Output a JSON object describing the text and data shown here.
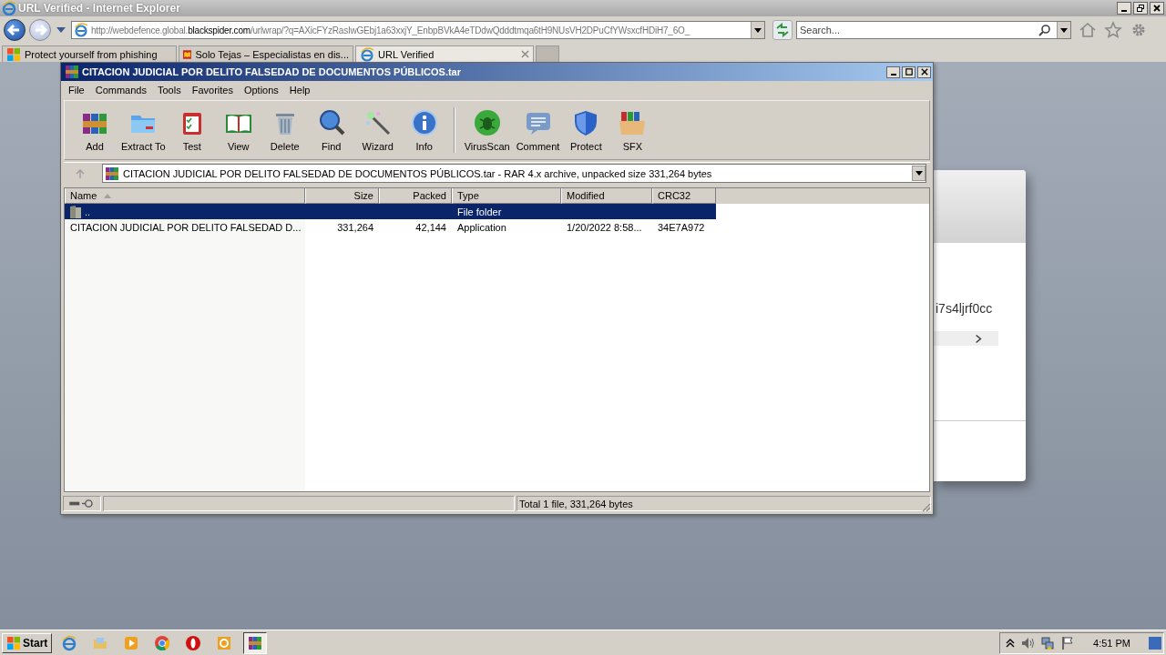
{
  "browser": {
    "title": "URL Verified - Internet Explorer",
    "address": "http://webdefence.global.**blackspider.com**/urlwrap/?q=AXicFYzRasIwGEbj1a63xxjY_EnbpBVkA4eTDdwQdddtmqa6tH9NUsVH2DPuCfYWsxcfHDiH7_6O_",
    "search_placeholder": "Search...",
    "tabs": [
      {
        "label": "Protect yourself from phishing",
        "selected": false
      },
      {
        "label": "Solo Tejas – Especialistas en dis...",
        "selected": false
      },
      {
        "label": "URL Verified",
        "selected": true
      }
    ]
  },
  "background_page": {
    "text": "i7s4ljrf0cc"
  },
  "winrar": {
    "title": "CITACION JUDICIAL POR DELITO FALSEDAD DE DOCUMENTOS PÚBLICOS.tar",
    "menu": [
      "File",
      "Commands",
      "Tools",
      "Favorites",
      "Options",
      "Help"
    ],
    "toolbar": [
      {
        "label": "Add",
        "kind": "add"
      },
      {
        "label": "Extract To",
        "kind": "extract"
      },
      {
        "label": "Test",
        "kind": "test"
      },
      {
        "label": "View",
        "kind": "view"
      },
      {
        "label": "Delete",
        "kind": "delete"
      },
      {
        "label": "Find",
        "kind": "find"
      },
      {
        "label": "Wizard",
        "kind": "wizard"
      },
      {
        "label": "Info",
        "kind": "info"
      },
      {
        "label": "VirusScan",
        "kind": "virus"
      },
      {
        "label": "Comment",
        "kind": "comment"
      },
      {
        "label": "Protect",
        "kind": "protect"
      },
      {
        "label": "SFX",
        "kind": "sfx"
      }
    ],
    "path": "CITACION JUDICIAL POR DELITO FALSEDAD DE DOCUMENTOS PÚBLICOS.tar - RAR 4.x archive, unpacked size 331,264 bytes",
    "columns": [
      "Name",
      "Size",
      "Packed",
      "Type",
      "Modified",
      "CRC32"
    ],
    "rows": [
      {
        "kind": "folder",
        "name": "..",
        "type": "File folder",
        "selected": true
      },
      {
        "kind": "file",
        "name": "CITACION JUDICIAL POR DELITO FALSEDAD D...",
        "size": "331,264",
        "packed": "42,144",
        "type": "Application",
        "modified": "1/20/2022 8:58...",
        "crc": "34E7A972",
        "selected": false
      }
    ],
    "status": "Total 1 file, 331,264 bytes"
  },
  "taskbar": {
    "start": "Start",
    "apps": [
      {
        "kind": "ie",
        "active": false
      },
      {
        "kind": "explorer",
        "active": false
      },
      {
        "kind": "media",
        "active": false
      },
      {
        "kind": "chrome",
        "active": false
      },
      {
        "kind": "opera",
        "active": false
      },
      {
        "kind": "orange",
        "active": false
      },
      {
        "kind": "winrar",
        "active": true
      }
    ],
    "clock": "4:51 PM"
  }
}
